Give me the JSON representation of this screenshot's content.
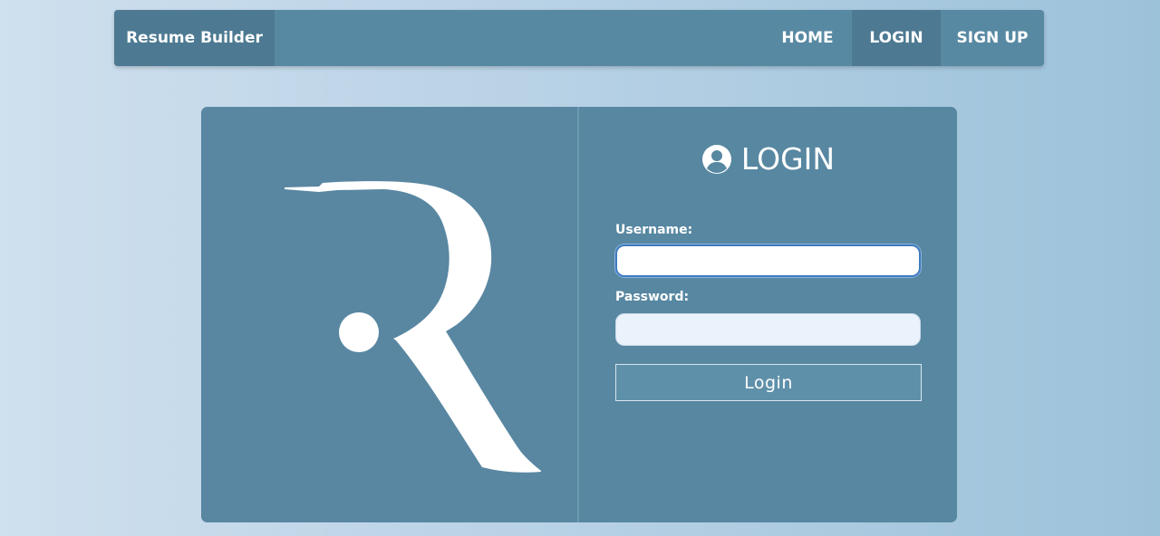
{
  "navbar": {
    "brand": "Resume Builder",
    "links": [
      "HOME",
      "LOGIN",
      "SIGN UP"
    ]
  },
  "logo": {
    "letter": "R"
  },
  "login_form": {
    "title": "LOGIN",
    "title_icon": "user-circle-icon",
    "username_label": "Username:",
    "username_value": "",
    "password_label": "Password:",
    "password_value": "",
    "submit_label": "Login"
  },
  "colors": {
    "nav_bg": "#5889a3",
    "nav_active": "#4d7a92",
    "card_bg": "#5787a1",
    "focus_border": "#3d7bbf"
  }
}
